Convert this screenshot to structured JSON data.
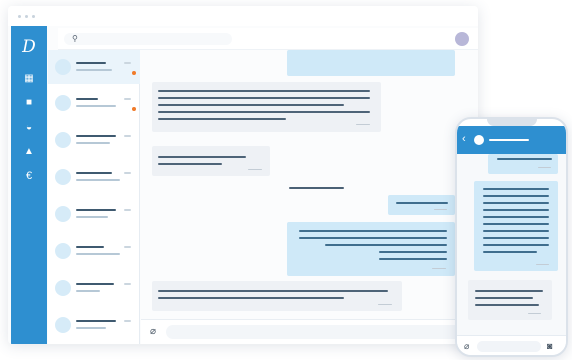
{
  "app": {
    "logo_glyph": "D",
    "accent": "#2e8fd0",
    "outgoing_bubble": "#cfe9f8",
    "incoming_bubble": "#eef1f5",
    "unread_dot": "#f07b2a"
  },
  "sidebar": {
    "items": [
      {
        "name": "calendar-icon",
        "glyph": "▦"
      },
      {
        "name": "video-icon",
        "glyph": "■"
      },
      {
        "name": "inbox-icon",
        "glyph": "◒"
      },
      {
        "name": "bell-icon",
        "glyph": "▲"
      },
      {
        "name": "euro-icon",
        "glyph": "€"
      }
    ]
  },
  "search": {
    "icon": "search-icon",
    "glyph": "⚲"
  },
  "conversations": [
    {
      "active": true,
      "unread": true
    },
    {
      "active": false,
      "unread": true
    },
    {
      "active": false,
      "unread": false
    },
    {
      "active": false,
      "unread": false
    },
    {
      "active": false,
      "unread": false
    },
    {
      "active": false,
      "unread": false
    },
    {
      "active": false,
      "unread": false
    },
    {
      "active": false,
      "unread": false
    }
  ],
  "composer": {
    "attach_glyph": "⌀"
  },
  "phone": {
    "back_glyph": "‹",
    "attach_glyph": "⌀",
    "camera_glyph": "◙"
  }
}
